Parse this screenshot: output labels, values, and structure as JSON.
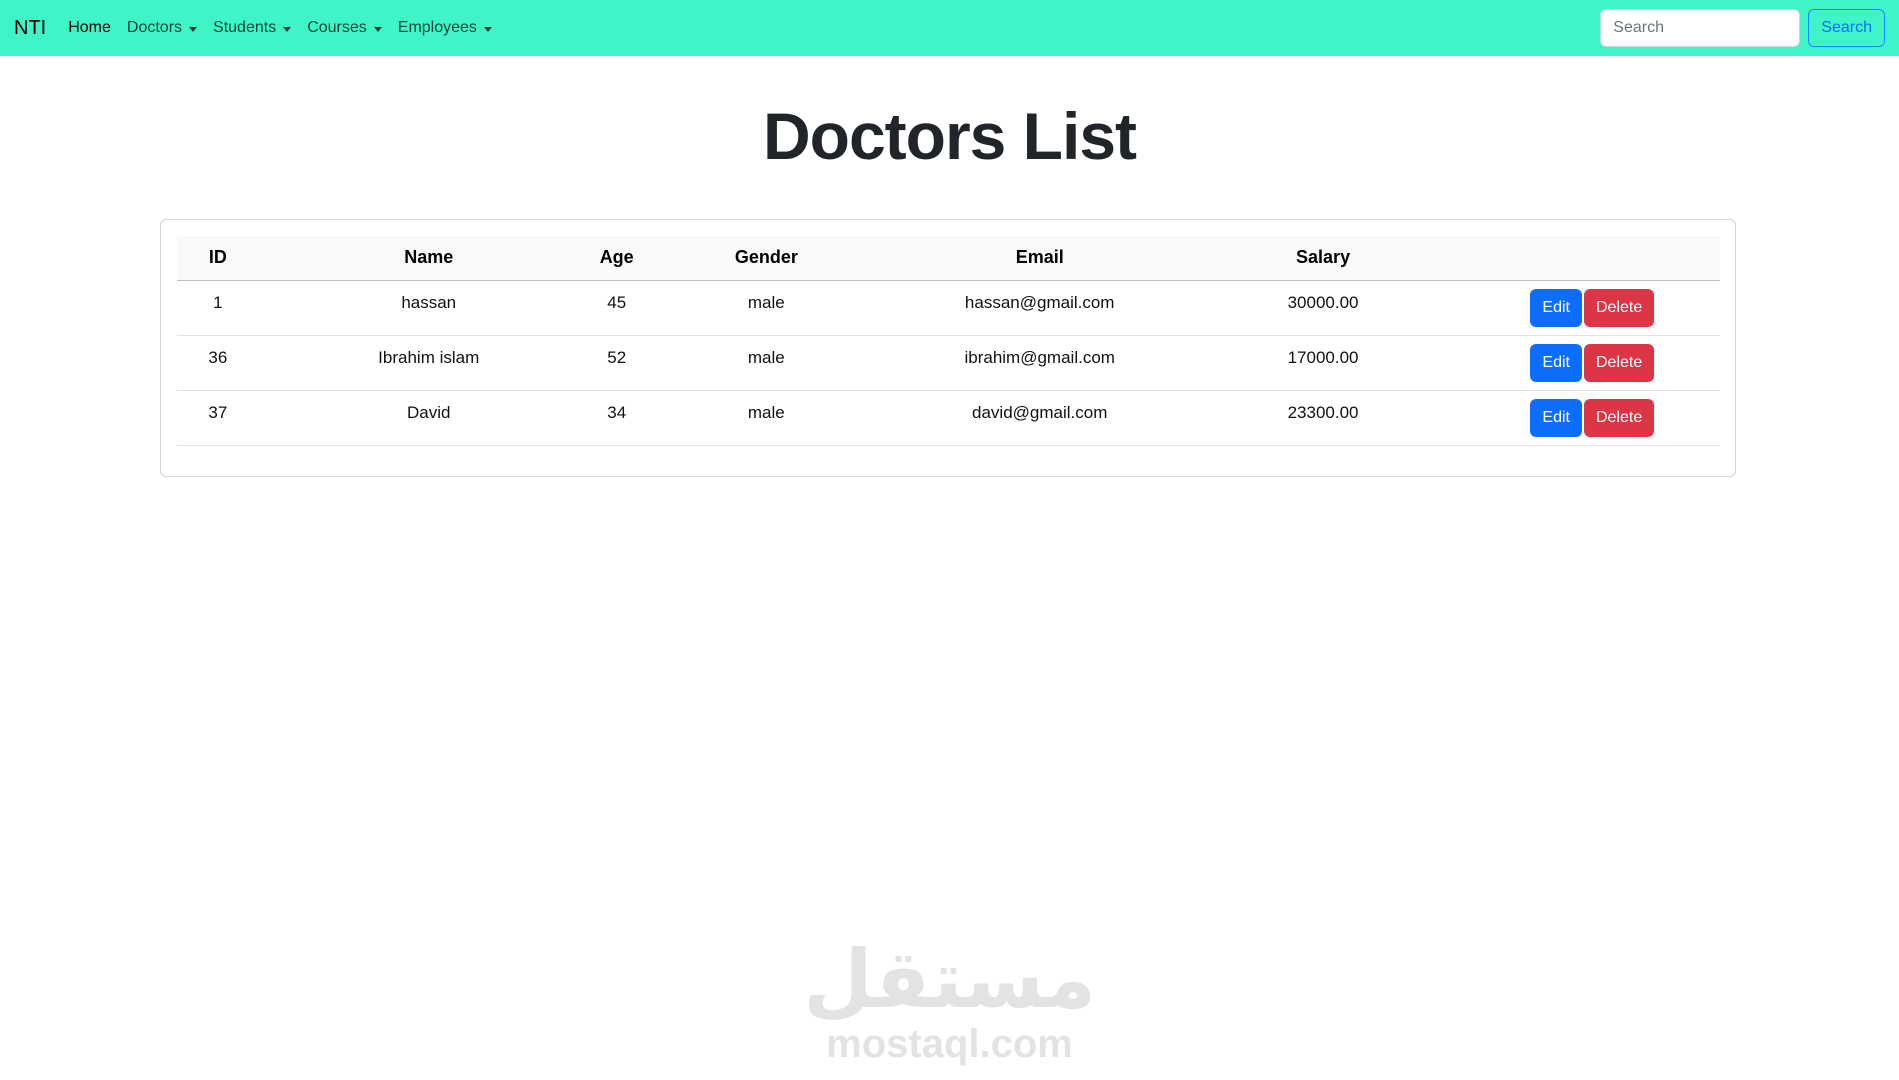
{
  "navbar": {
    "brand": "NTI",
    "items": [
      {
        "label": "Home",
        "dropdown": false,
        "active": true
      },
      {
        "label": "Doctors",
        "dropdown": true,
        "active": false
      },
      {
        "label": "Students",
        "dropdown": true,
        "active": false
      },
      {
        "label": "Courses",
        "dropdown": true,
        "active": false
      },
      {
        "label": "Employees",
        "dropdown": true,
        "active": false
      }
    ],
    "search": {
      "placeholder": "Search",
      "value": "",
      "button_label": "Search"
    },
    "background_color": "#3ff5c8"
  },
  "page": {
    "title": "Doctors List"
  },
  "table": {
    "headers": [
      "ID",
      "Name",
      "Age",
      "Gender",
      "Email",
      "Salary",
      ""
    ],
    "rows": [
      {
        "id": "1",
        "name": "hassan",
        "age": "45",
        "gender": "male",
        "email": "hassan@gmail.com",
        "salary": "30000.00"
      },
      {
        "id": "36",
        "name": "Ibrahim islam",
        "age": "52",
        "gender": "male",
        "email": "ibrahim@gmail.com",
        "salary": "17000.00"
      },
      {
        "id": "37",
        "name": "David",
        "age": "34",
        "gender": "male",
        "email": "david@gmail.com",
        "salary": "23300.00"
      }
    ],
    "edit_label": "Edit",
    "delete_label": "Delete",
    "edit_color": "#0d6efd",
    "delete_color": "#dc3545"
  },
  "watermark": {
    "arabic": "مستقل",
    "latin": "mostaql.com"
  }
}
